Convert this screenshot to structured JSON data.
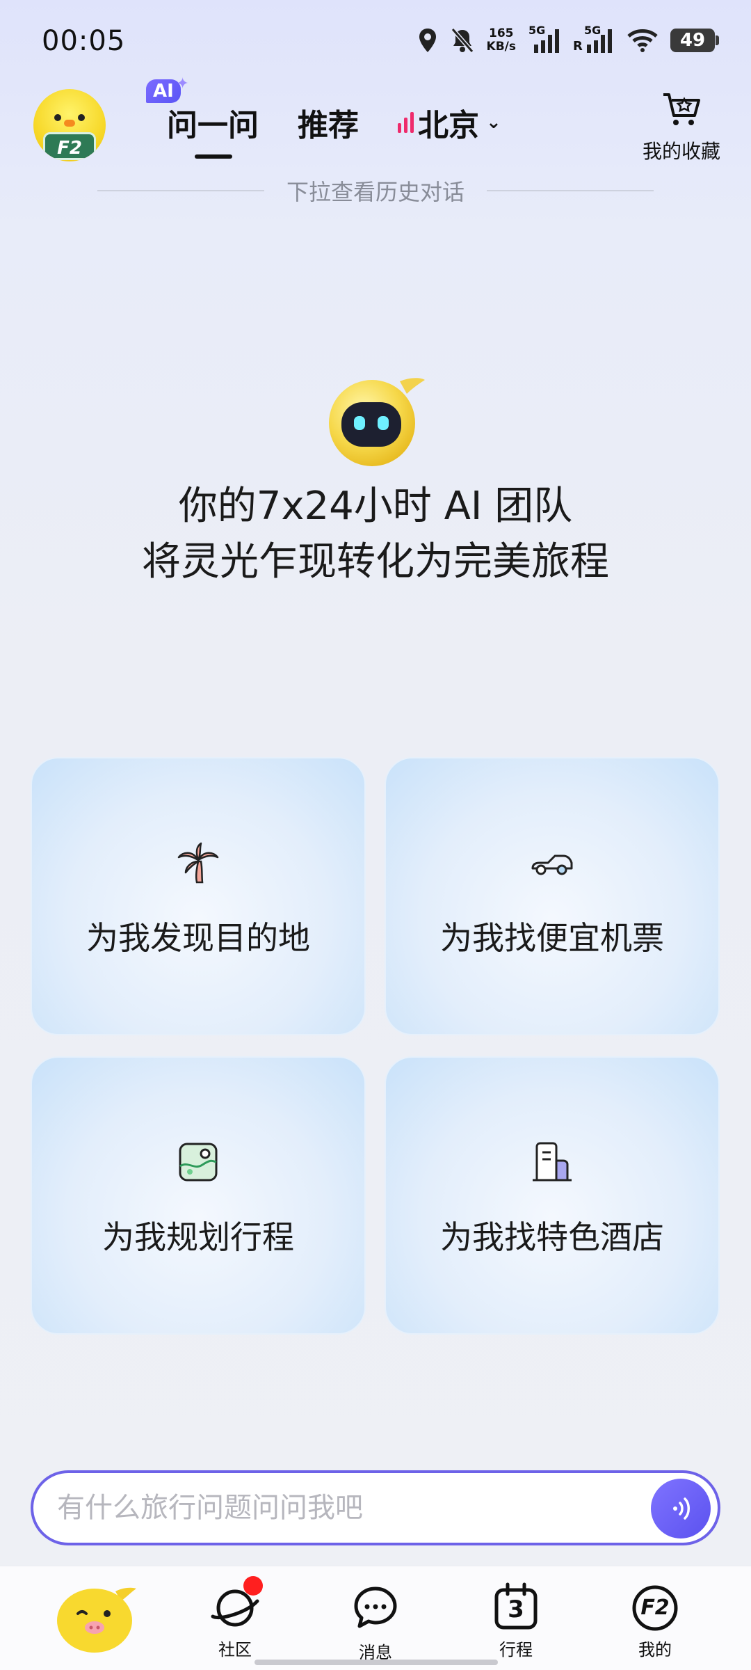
{
  "status_bar": {
    "time": "00:05",
    "net_speed_value": "165",
    "net_speed_unit": "KB/s",
    "sim1_label": "5G",
    "sim2_label": "5G",
    "sim2_roaming": "R",
    "battery": "49"
  },
  "header": {
    "ai_badge": "AI",
    "tabs": [
      {
        "label": "问一问",
        "active": true
      },
      {
        "label": "推荐",
        "active": false
      },
      {
        "label": "北京",
        "active": false
      }
    ],
    "favorites_label": "我的收藏",
    "avatar_badge": "F2"
  },
  "pull_hint": "下拉查看历史对话",
  "headline": {
    "line1": "你的7x24小时 AI 团队",
    "line2": "将灵光乍现转化为完美旅程"
  },
  "cards": [
    {
      "label": "为我发现目的地",
      "icon": "palm-tree-icon"
    },
    {
      "label": "为我找便宜机票",
      "icon": "plane-icon"
    },
    {
      "label": "为我规划行程",
      "icon": "map-icon"
    },
    {
      "label": "为我找特色酒店",
      "icon": "hotel-icon"
    }
  ],
  "input": {
    "placeholder": "有什么旅行问题问问我吧"
  },
  "bottom_nav": [
    {
      "label": "",
      "icon": "pig-mascot-icon"
    },
    {
      "label": "社区",
      "icon": "planet-icon",
      "has_notification_dot": true
    },
    {
      "label": "消息",
      "icon": "chat-bubble-icon"
    },
    {
      "label": "行程",
      "icon": "calendar-icon",
      "icon_text": "3"
    },
    {
      "label": "我的",
      "icon": "profile-f2-icon",
      "icon_text": "F2"
    }
  ],
  "colors": {
    "accent": "#6d62e8",
    "city_bars": "#ee2b6c",
    "notification": "#ff1f1f"
  }
}
